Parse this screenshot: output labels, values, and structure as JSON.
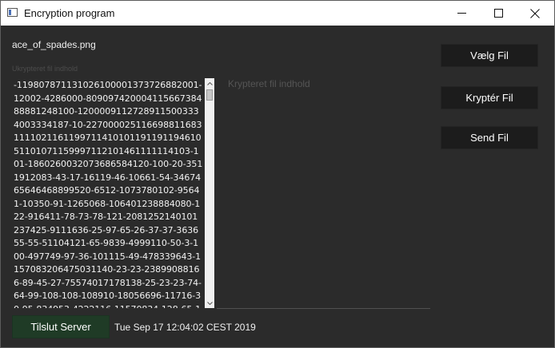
{
  "window": {
    "title": "Encryption program"
  },
  "file": {
    "name": "ace_of_spades.png"
  },
  "unencrypted": {
    "label": "Ukrypteret fil indhold",
    "content": "-11980787113102610000137372688200​1-12002-4286000-80909742000411566738488881248100-12000091127289115003334003334187-10-227000025116698811683111102116119971141010119119119461051101071159997112101461111114103-101-1860260032073686584120-100-20-3511912083-43-17-16119-46-10661-54-3467465646468899520-6512-1073780102-95641-10350-91-1265068-106401238884080-122-916411-78-73-78-121-2081252140101237425-9111636-25-97-65-26-37-37-363655-55-51104121-65-9839-4999110-50-3-100-497749-97-36-101115-49-478339643-1157083206475031140-23-23-23899088166-89-45-27-75574017178138-25-23-23-74-64-99-108-108-108910-18056696-11716-30-95-834953-4222116-11570834-128-65-1"
  },
  "encrypted": {
    "placeholder": "Krypteret fil indhold"
  },
  "buttons": {
    "choose_file": "Vælg Fil",
    "encrypt": "Kryptér Fil",
    "send": "Send Fil",
    "connect": "Tilslut Server"
  },
  "status": {
    "timestamp": "Tue Sep 17 12:04:02 CEST 2019"
  },
  "icons": {
    "app": "window-icon",
    "minimize": "minimize-icon",
    "maximize": "maximize-icon",
    "close": "close-icon",
    "scroll_up": "arrow-up-icon",
    "scroll_down": "arrow-down-icon"
  },
  "colors": {
    "background": "#2b2b2b",
    "button": "#1c1c1c",
    "connect_button": "#1f3b26",
    "text": "#f0f0f0"
  }
}
